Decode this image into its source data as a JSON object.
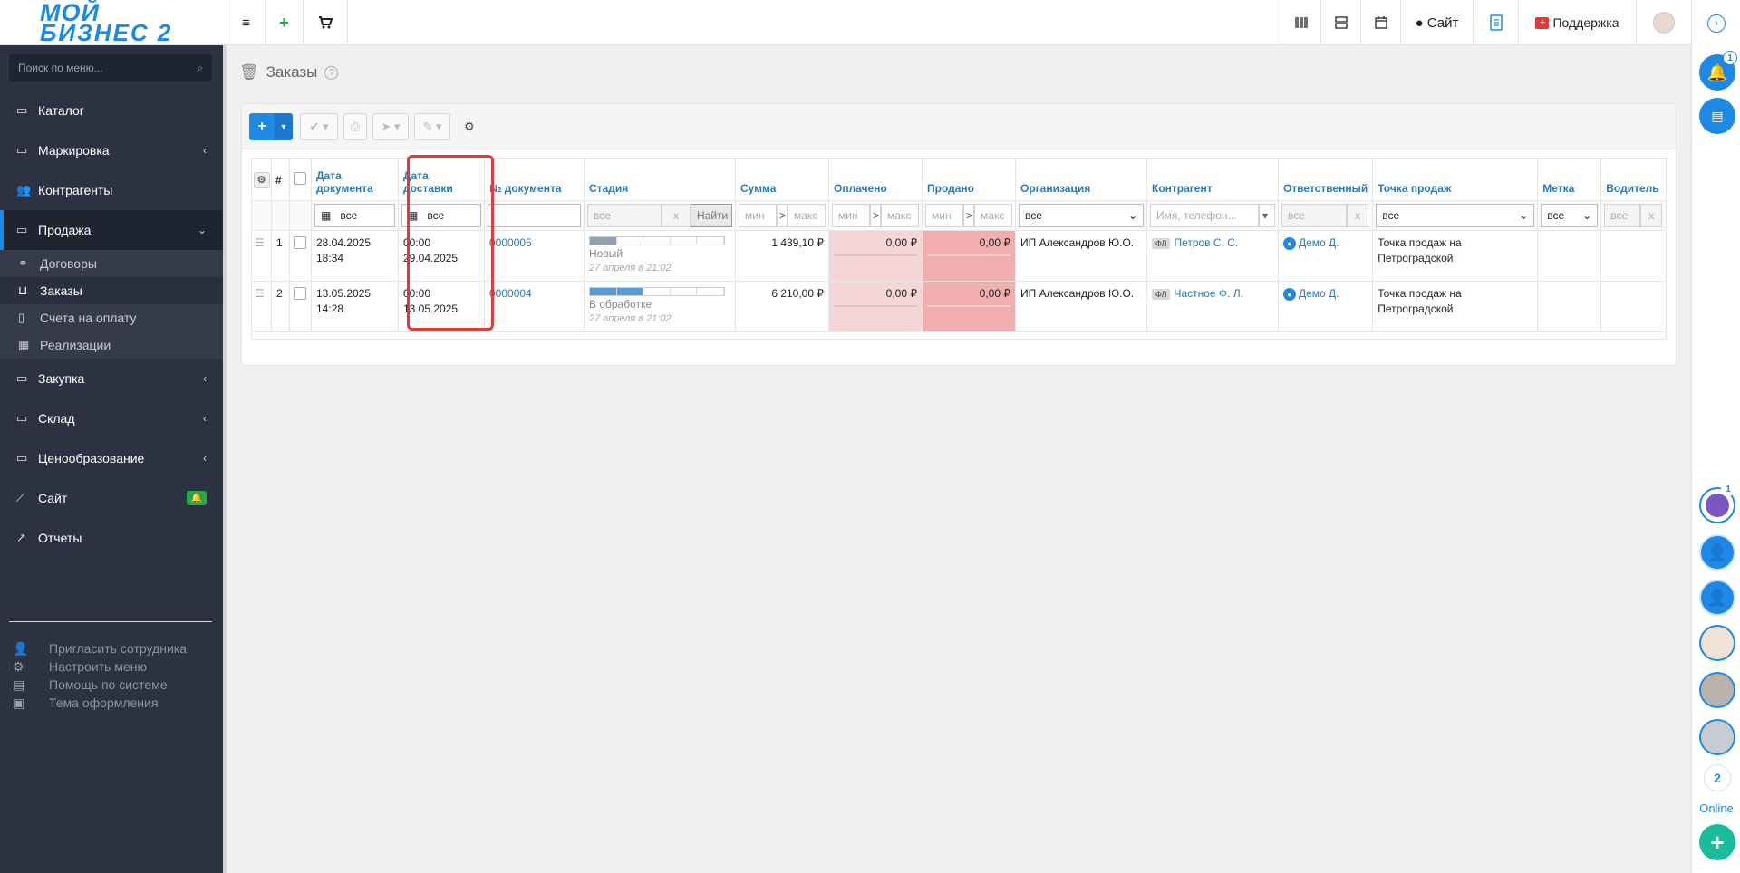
{
  "header": {
    "logo_line1": "МОЙ",
    "logo_line2": "БИЗНЕС 2",
    "site_label": "Сайт",
    "support_label": "Поддержка"
  },
  "sidebar": {
    "search_placeholder": "Поиск по меню...",
    "items": [
      {
        "label": "Каталог",
        "icon": "folder-icon"
      },
      {
        "label": "Маркировка",
        "icon": "folder-icon"
      },
      {
        "label": "Контрагенты",
        "icon": "users-icon"
      },
      {
        "label": "Продажа",
        "icon": "folder-icon"
      },
      {
        "label": "Закупка",
        "icon": "folder-icon"
      },
      {
        "label": "Склад",
        "icon": "folder-icon"
      },
      {
        "label": "Ценообразование",
        "icon": "folder-icon"
      },
      {
        "label": "Сайт",
        "icon": "magic-wand-icon"
      },
      {
        "label": "Отчеты",
        "icon": "chart-icon"
      }
    ],
    "sub_items": [
      {
        "label": "Договоры"
      },
      {
        "label": "Заказы"
      },
      {
        "label": "Счета на оплату"
      },
      {
        "label": "Реализации"
      }
    ],
    "extras": [
      {
        "label": "Пригласить сотрудника"
      },
      {
        "label": "Настроить меню"
      },
      {
        "label": "Помощь по системе"
      },
      {
        "label": "Тема оформления"
      }
    ]
  },
  "page": {
    "title": "Заказы"
  },
  "table": {
    "columns": {
      "num": "#",
      "doc_date_1": "Дата",
      "doc_date_2": "документа",
      "del_date_1": "Дата",
      "del_date_2": "доставки",
      "doc_no": "№ документа",
      "stage": "Стадия",
      "sum": "Сумма",
      "paid": "Оплачено",
      "sold": "Продано",
      "org": "Организация",
      "contractor": "Контрагент",
      "responsible": "Ответственный",
      "point": "Точка продаж",
      "mark": "Метка",
      "driver": "Водитель"
    },
    "filters": {
      "all": "все",
      "stage_placeholder": "все",
      "find": "Найти",
      "min": "мин",
      "max": "макс",
      "contractor_placeholder": "Имя, телефон...",
      "clear": "x",
      "gt": ">"
    },
    "rows": [
      {
        "num": "1",
        "doc_date": "28.04.2025",
        "doc_time": "18:34",
        "del_time": "00:00",
        "del_date": "29.04.2025",
        "doc_no": "0000005",
        "stage": "Новый",
        "stage_fill": 1,
        "stage_note": "27 апреля в 21:02",
        "sum": "1 439,10 ₽",
        "paid": "0,00 ₽",
        "sold": "0,00 ₽",
        "org": "ИП Александров Ю.О.",
        "contractor_tag": "ФЛ",
        "contractor": "Петров С. С.",
        "responsible": "Демо Д.",
        "point_1": "Точка продаж на",
        "point_2": "Петроградской"
      },
      {
        "num": "2",
        "doc_date": "13.05.2025",
        "doc_time": "14:28",
        "del_time": "00:00",
        "del_date": "13.05.2025",
        "doc_no": "0000004",
        "stage": "В обработке",
        "stage_fill": 2,
        "stage_note": "27 апреля в 21:02",
        "sum": "6 210,00 ₽",
        "paid": "0,00 ₽",
        "sold": "0,00 ₽",
        "org": "ИП Александров Ю.О.",
        "contractor_tag": "ФЛ",
        "contractor": "Частное Ф. Л.",
        "responsible": "Демо Д.",
        "point_1": "Точка продаж на",
        "point_2": "Петроградской"
      }
    ]
  },
  "rail": {
    "notif_count": "1",
    "chat_count": "1",
    "online_count": "2",
    "online_label": "Online"
  },
  "colors": {
    "accent": "#1e88e5",
    "sidebar": "#2c3241",
    "highlight": "#e53935"
  }
}
